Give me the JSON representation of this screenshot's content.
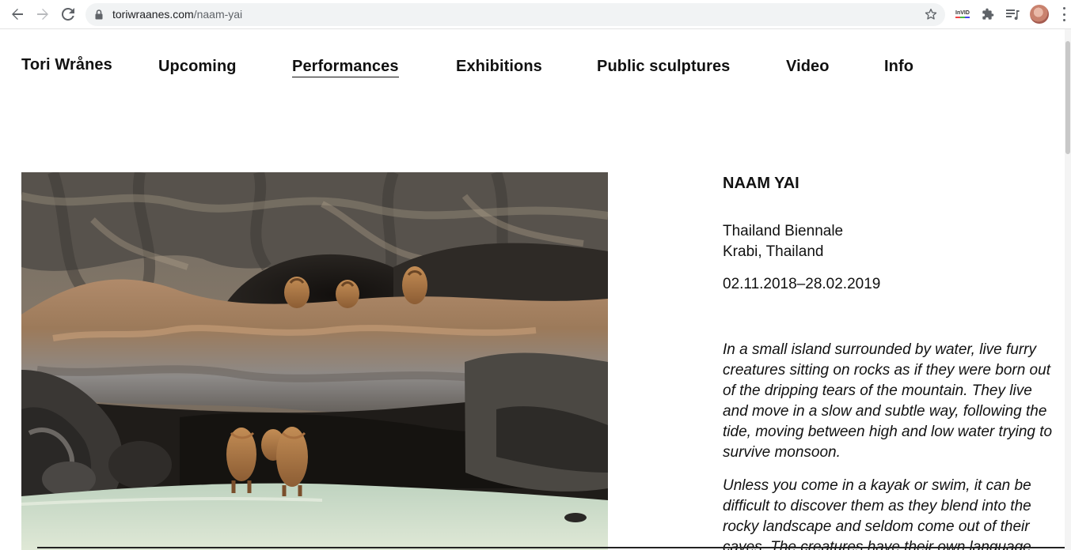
{
  "browser": {
    "url_host": "toriwraanes.com",
    "url_path": "/naam-yai",
    "icons": [
      "back-icon",
      "forward-icon",
      "reload-icon",
      "lock-icon",
      "star-icon",
      "invid-extension-icon",
      "puzzle-icon",
      "media-queue-icon",
      "avatar",
      "more-menu-icon"
    ],
    "invid_label": "InVID"
  },
  "nav": {
    "brand": "Tori Wrånes",
    "items": [
      {
        "label": "Upcoming",
        "active": false
      },
      {
        "label": "Performances",
        "active": true
      },
      {
        "label": "Exhibitions",
        "active": false
      },
      {
        "label": "Public sculptures",
        "active": false
      },
      {
        "label": "Video",
        "active": false
      },
      {
        "label": "Info",
        "active": false
      }
    ]
  },
  "work": {
    "title": "NAAM YAI",
    "venue_line1": "Thailand Biennale",
    "venue_line2": "Krabi, Thailand",
    "dates": "02.11.2018–28.02.2019",
    "paragraphs": [
      "In a small island surrounded by water, live furry creatures sitting on rocks as if they were born out of the dripping tears of the mountain. They live and move in a slow and subtle way, following the tide, moving between high and low water trying to survive monsoon.",
      "Unless you come in a kayak or swim, it can be difficult to discover them as they blend into the rocky landscape and seldom come out of their caves. The creatures have their own language"
    ]
  },
  "colors": {
    "text": "#111111",
    "chrome_bg": "#f1f3f4",
    "chrome_icon": "#5f6368"
  }
}
